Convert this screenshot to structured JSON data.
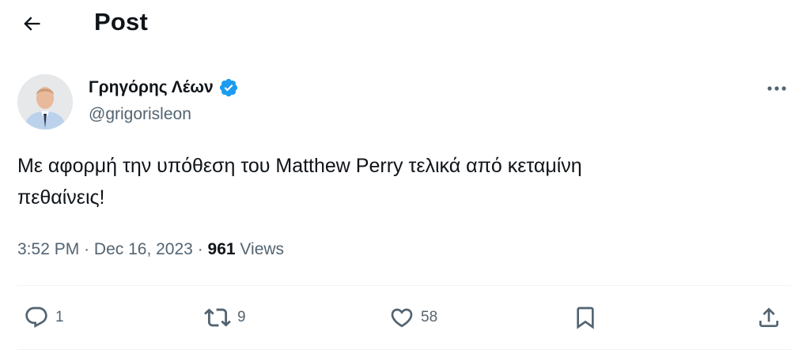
{
  "header": {
    "title": "Post",
    "back_icon": "arrow-left-icon"
  },
  "author": {
    "name": "Γρηγόρης Λέων",
    "handle": "@grigorisleon",
    "verified": true,
    "verified_color": "#1d9bf0"
  },
  "tweet": {
    "text_line1": "Με αφορμή την υπόθεση του Matthew Perry τελικά από κεταμίνη",
    "text_line2": "πεθαίνεις!",
    "time": "3:52 PM",
    "separator": "·",
    "date": "Dec 16, 2023",
    "views_count": "961",
    "views_label": "Views"
  },
  "actions": {
    "reply_count": "1",
    "retweet_count": "9",
    "like_count": "58"
  },
  "colors": {
    "text_primary": "#0f1419",
    "text_secondary": "#536471",
    "divider": "#eff3f4"
  }
}
